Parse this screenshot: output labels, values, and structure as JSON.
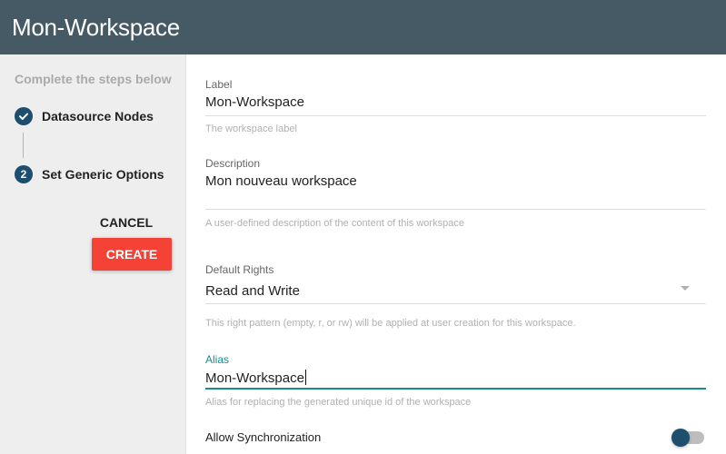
{
  "window": {
    "title": "Mon-Workspace"
  },
  "stepper": {
    "header": "Complete the steps below",
    "steps": [
      {
        "number": "✓",
        "label": "Datasource Nodes",
        "state": "completed"
      },
      {
        "number": "2",
        "label": "Set Generic Options",
        "state": "active"
      }
    ],
    "cancel_label": "CANCEL",
    "create_label": "CREATE"
  },
  "form": {
    "label_field": {
      "label": "Label",
      "value": "Mon-Workspace",
      "hint": "The workspace label"
    },
    "description_field": {
      "label": "Description",
      "value": "Mon nouveau workspace",
      "hint": "A user-defined description of the content of this workspace"
    },
    "rights_field": {
      "label": "Default Rights",
      "value": "Read and Write",
      "hint": "This right pattern (empty, r, or rw) will be applied at user creation for this workspace."
    },
    "alias_field": {
      "label": "Alias",
      "value": "Mon-Workspace",
      "hint": "Alias for replacing the generated unique id of the workspace"
    },
    "sync_toggle": {
      "label": "Allow Synchronization",
      "enabled": true
    }
  },
  "colors": {
    "titlebar": "#455a64",
    "accent": "#1b8c8c",
    "step_circle": "#1d4e6e",
    "create_button": "#f44336"
  }
}
